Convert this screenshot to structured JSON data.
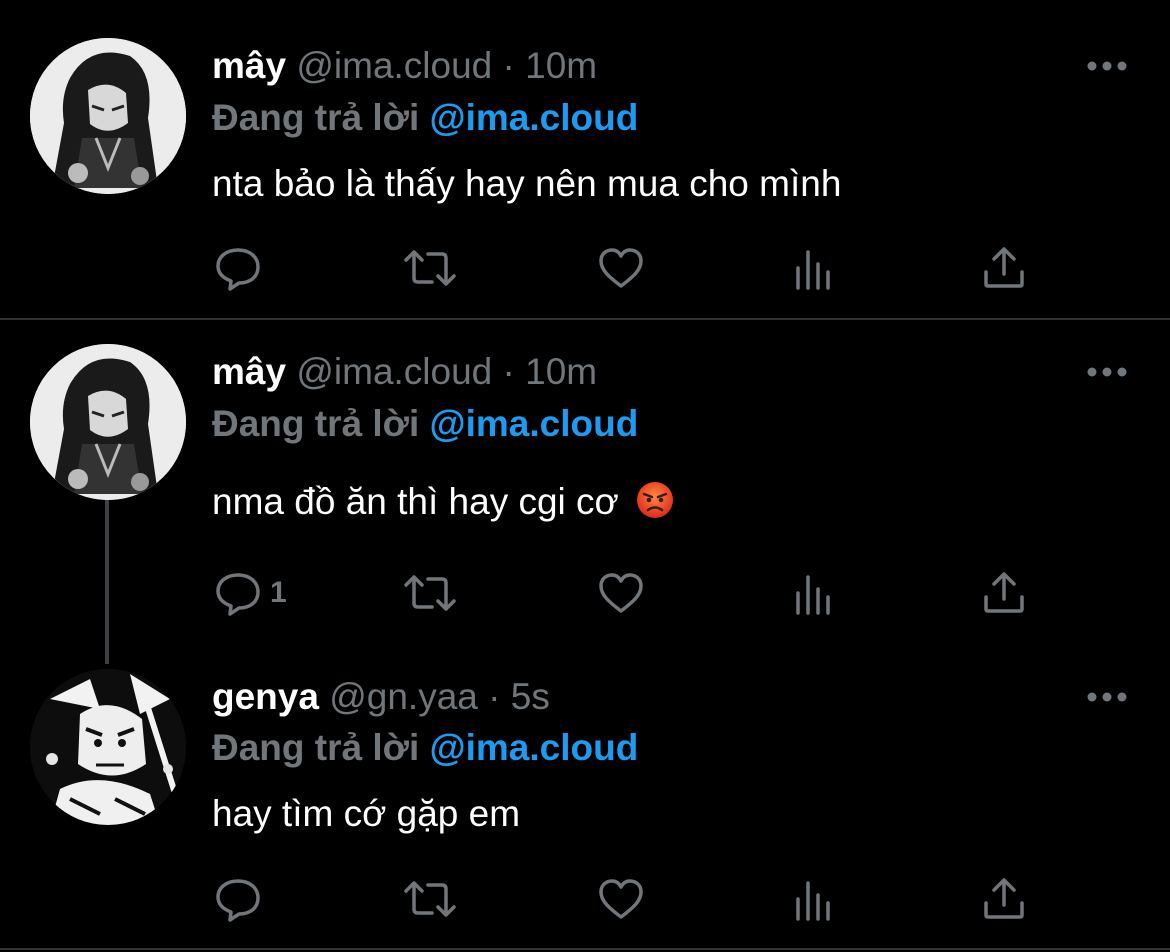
{
  "tweets": [
    {
      "name": "mây",
      "handle": "@ima.cloud",
      "dot": "·",
      "time": "10m",
      "reply_prefix": "Đang trả lời",
      "reply_to": "@ima.cloud",
      "text": "nta bảo là thấy hay nên mua cho mình",
      "reply_count": ""
    },
    {
      "name": "mây",
      "handle": "@ima.cloud",
      "dot": "·",
      "time": "10m",
      "reply_prefix": "Đang trả lời",
      "reply_to": "@ima.cloud",
      "text": "nma đồ ăn thì hay cgi cơ",
      "emoji": "angry-face-emoji",
      "reply_count": "1"
    },
    {
      "name": "genya",
      "handle": "@gn.yaa",
      "dot": "·",
      "time": "5s",
      "reply_prefix": "Đang trả lời",
      "reply_to": "@ima.cloud",
      "text": "hay tìm cớ gặp em",
      "reply_count": ""
    }
  ],
  "colors": {
    "background": "#000000",
    "text": "#ffffff",
    "secondary": "#71767b",
    "accent": "#1d9bf0",
    "divider": "#2f3336"
  },
  "icons": [
    "reply-icon",
    "retweet-icon",
    "like-icon",
    "views-icon",
    "share-icon",
    "more-icon"
  ]
}
